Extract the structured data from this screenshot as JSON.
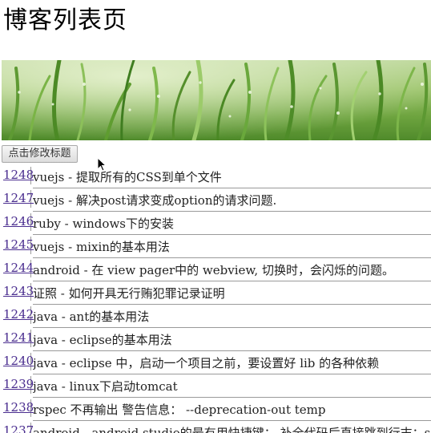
{
  "header": {
    "title": "博客列表页"
  },
  "toolbar": {
    "edit_title_button": "点击修改标题"
  },
  "posts": [
    {
      "id": "1248",
      "text": "vuejs - 提取所有的CSS到单个文件"
    },
    {
      "id": "1247",
      "text": "vuejs - 解决post请求变成option的请求问题."
    },
    {
      "id": "1246",
      "text": "ruby - windows下的安装"
    },
    {
      "id": "1245",
      "text": "vuejs - mixin的基本用法"
    },
    {
      "id": "1244",
      "text": "android - 在 view pager中的 webview, 切换时，会闪烁的问题。"
    },
    {
      "id": "1243",
      "text": "证照 - 如何开具无行贿犯罪记录证明"
    },
    {
      "id": "1242",
      "text": "java - ant的基本用法"
    },
    {
      "id": "1241",
      "text": "java - eclipse的基本用法"
    },
    {
      "id": "1240",
      "text": "java - eclipse 中，启动一个项目之前，要设置好 lib 的各种依赖"
    },
    {
      "id": "1239",
      "text": "java - linux下启动tomcat"
    },
    {
      "id": "1238",
      "text": "rspec 不再输出 警告信息： --deprecation-out temp"
    },
    {
      "id": "1237",
      "text": "android - android studio的最有用快捷键： 补全代码后直接跳到行末：s"
    }
  ]
}
